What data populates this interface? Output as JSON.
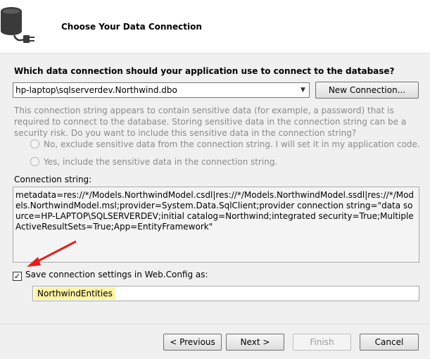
{
  "header": {
    "title": "Choose Your Data Connection",
    "icon": "database-plug-icon"
  },
  "question": "Which data connection should your application use to connect to the database?",
  "connection_select": {
    "value": "hp-laptop\\sqlserverdev.Northwind.dbo"
  },
  "new_connection_label": "New Connection...",
  "sensitive_text": "This connection string appears to contain sensitive data (for example, a password) that is required to connect to the database. Storing sensitive data in the connection string can be a security risk. Do you want to include this sensitive data in the connection string?",
  "radios": [
    {
      "label": "No, exclude sensitive data from the connection string. I will set it in my application code.",
      "selected": false,
      "enabled": false
    },
    {
      "label": "Yes, include the sensitive data in the connection string.",
      "selected": false,
      "enabled": false
    }
  ],
  "connection_string_label": "Connection string:",
  "connection_string": "metadata=res://*/Models.NorthwindModel.csdl|res://*/Models.NorthwindModel.ssdl|res://*/Models.NorthwindModel.msl;provider=System.Data.SqlClient;provider connection string=\"data source=HP-LAPTOP\\SQLSERVERDEV;initial catalog=Northwind;integrated security=True;MultipleActiveResultSets=True;App=EntityFramework\"",
  "save_settings": {
    "label": "Save connection settings in Web.Config as:",
    "checked": true,
    "name_value": "NorthwindEntities"
  },
  "buttons": {
    "previous": "< Previous",
    "next": "Next >",
    "finish": "Finish",
    "cancel": "Cancel"
  },
  "colors": {
    "highlight": "#fbf4a3",
    "annotation_arrow": "#e02020"
  }
}
